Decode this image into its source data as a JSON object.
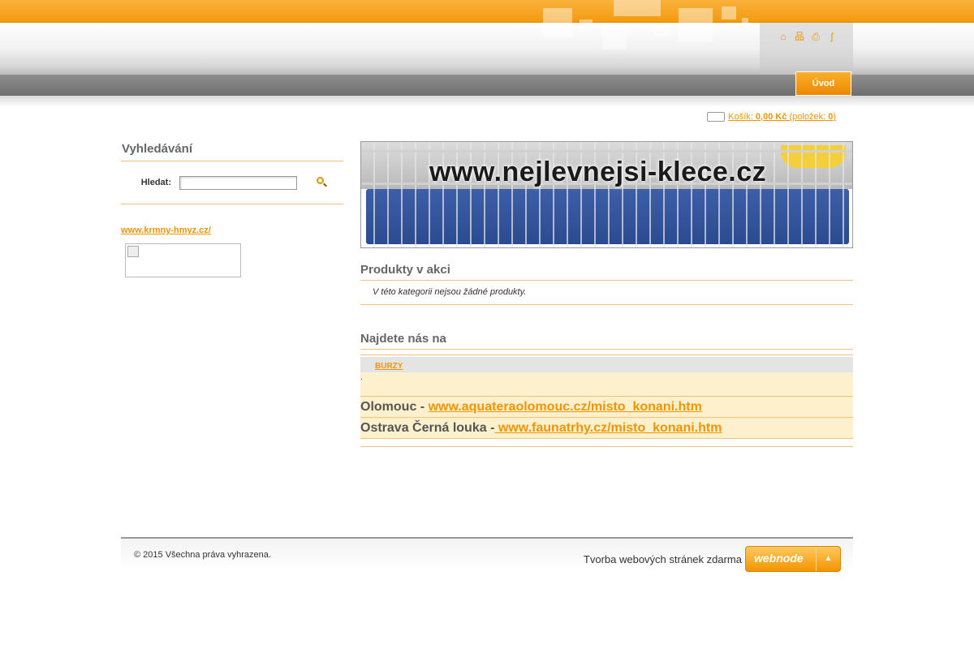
{
  "header": {
    "icons": [
      "home-icon",
      "sitemap-icon",
      "print-icon",
      "rss-icon"
    ],
    "nav": {
      "uvod_label": "Úvod"
    }
  },
  "cart": {
    "label": "Košík:",
    "amount": "0,00 Kč",
    "items_prefix": "(položek:",
    "items_count": "0",
    "items_suffix": ")"
  },
  "sidebar": {
    "search_title": "Vyhledávání",
    "search_label": "Hledat:",
    "search_value": "",
    "link": "www.krmny-hmyz.cz/"
  },
  "main": {
    "banner_text": "www.nejlevnejsi-klece.cz",
    "promo_title": "Produkty v akci",
    "promo_empty": "V této kategorii nejsou žádné produkty.",
    "find_title": "Najdete nás na",
    "find_tab": "BURZY",
    "dot": ".",
    "locations": [
      {
        "city": "Olomouc - ",
        "url": " www.aquateraolomouc.cz/misto_konani.htm"
      },
      {
        "city": "Ostrava Černá louka -",
        "url": " www.faunatrhy.cz/misto_konani.htm"
      }
    ]
  },
  "footer": {
    "copyright": "© 2015 Všechna práva vyhrazena.",
    "credit": "Tvorba webových stránek zdarma",
    "logo": "webnode",
    "colors": {
      "accent": "#f29400",
      "topbar": "#f39a10"
    }
  }
}
